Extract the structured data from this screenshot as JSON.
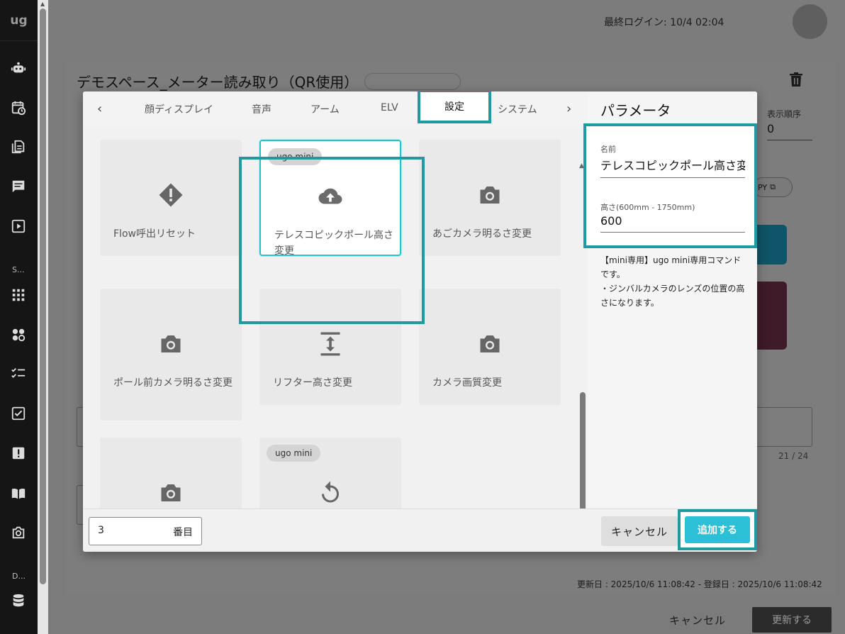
{
  "app": {
    "logo": "ug"
  },
  "sidebar": {
    "sections": [
      "S...",
      "D..."
    ],
    "icons": [
      "robot-icon",
      "calendar-clock-icon",
      "documents-icon",
      "chat-icon",
      "play-icon",
      "apps-grid-icon",
      "widgets-icon",
      "checklist-icon",
      "task-check-icon",
      "alert-icon",
      "manual-book-icon",
      "camera-icon",
      "database-icon"
    ]
  },
  "header": {
    "last_login": "最終ログイン: 10/4 02:04"
  },
  "background": {
    "title": "デモスペース_メーター読み取り（QR使用）",
    "order_label": "表示順序",
    "order_value": "0",
    "copy_label": "PY",
    "char_count": "21 / 24",
    "timestamps": "更新日 : 2025/10/6 11:08:42 - 登録日 : 2025/10/6 11:08:42",
    "cancel_label": "キャンセル",
    "update_label": "更新する"
  },
  "modal": {
    "tabs": [
      {
        "label": "顔ディスプレイ"
      },
      {
        "label": "音声"
      },
      {
        "label": "アーム"
      },
      {
        "label": "ELV"
      },
      {
        "label": "設定",
        "active": true
      },
      {
        "label": "システム"
      }
    ],
    "tiles": [
      {
        "label": "Flow呼出リセット",
        "icon": "alert-diamond-icon"
      },
      {
        "chip": "ugo mini",
        "label": "テレスコピックポール高さ変更",
        "icon": "cloud-upload-icon",
        "selected": true
      },
      {
        "label": "あごカメラ明るさ変更",
        "icon": "camera-icon"
      },
      {
        "label": "ポール前カメラ明るさ変更",
        "icon": "camera-icon"
      },
      {
        "label": "リフター高さ変更",
        "icon": "vertical-resize-icon"
      },
      {
        "label": "カメラ画質変更",
        "icon": "camera-icon"
      },
      {
        "label": "",
        "icon": "camera-icon"
      },
      {
        "chip": "ugo mini",
        "label": "",
        "icon": "rotate-icon"
      }
    ],
    "params": {
      "title": "パラメータ",
      "name_label": "名前",
      "name_value": "テレスコピックポール高さ変更",
      "height_label": "高さ(600mm - 1750mm)",
      "height_value": "600",
      "description_line1": "【mini専用】ugo mini専用コマンドです。",
      "description_line2": "・ジンバルカメラのレンズの位置の高さになります。"
    },
    "footer": {
      "order_value": "3",
      "order_unit": "番目",
      "cancel_label": "キャンセル",
      "add_label": "追加する"
    }
  },
  "colors": {
    "highlight": "#1f9aa3",
    "accent": "#2bc0d6",
    "overlay": "#7b7b7b",
    "sidebar": "#151515"
  }
}
